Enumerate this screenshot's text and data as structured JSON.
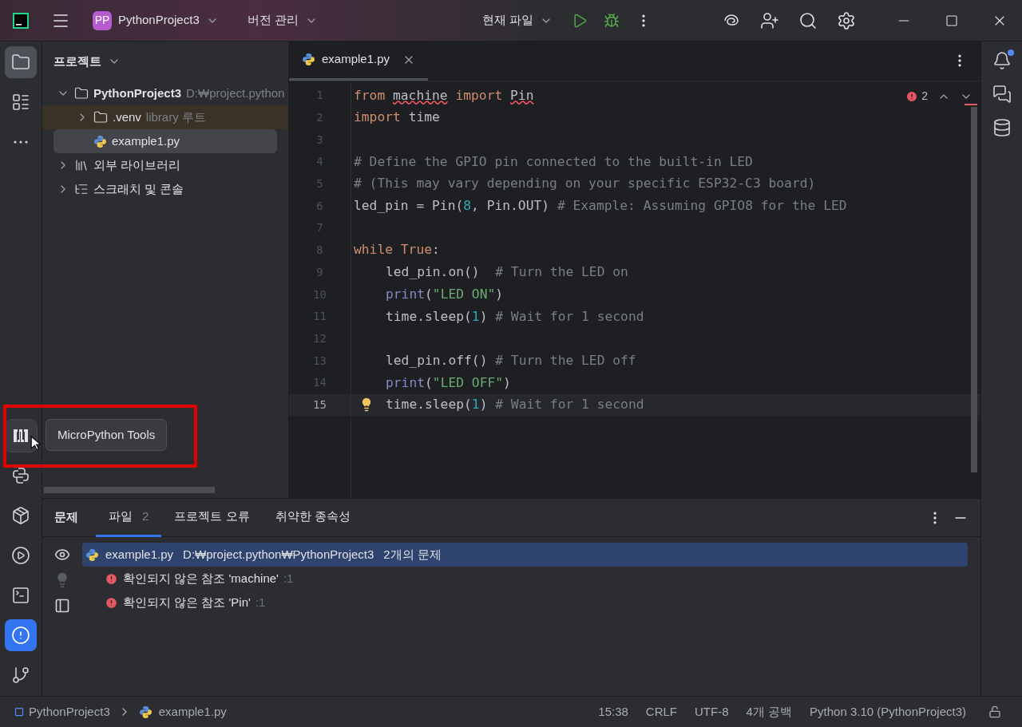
{
  "title_bar": {
    "project_badge": "PP",
    "project": "PythonProject3",
    "vcs": "버전 관리",
    "run_config": "현재 파일"
  },
  "tool_strip": {
    "top": [
      {
        "kind": "folder",
        "selected": true,
        "hovered": false
      },
      {
        "kind": "structure",
        "selected": false,
        "hovered": false
      },
      {
        "kind": "more",
        "selected": false,
        "hovered": false
      }
    ],
    "bottom": [
      {
        "kind": "micropython",
        "selected": false,
        "hovered": true
      },
      {
        "kind": "python",
        "selected": false,
        "hovered": false
      },
      {
        "kind": "packages",
        "selected": false,
        "hovered": false
      },
      {
        "kind": "run",
        "selected": false,
        "hovered": false
      },
      {
        "kind": "terminal",
        "selected": false,
        "hovered": false
      },
      {
        "kind": "problems",
        "selected": true,
        "hovered": false
      },
      {
        "kind": "git",
        "selected": false,
        "hovered": false
      }
    ]
  },
  "tooltip": "MicroPython Tools",
  "project_panel": {
    "title": "프로젝트",
    "tree": [
      {
        "kind": "folder",
        "label": "PythonProject3",
        "note": "D:₩project.python",
        "expanded": true,
        "selected": false,
        "excluded": false,
        "children": [
          {
            "kind": "folder",
            "label": ".venv",
            "note": "library 루트",
            "expanded": false,
            "selected": false,
            "excluded": true
          },
          {
            "kind": "python",
            "label": "example1.py",
            "selected": true,
            "excluded": false
          }
        ]
      },
      {
        "kind": "library",
        "label": "외부 라이브러리",
        "expanded": false,
        "selected": false,
        "excluded": false
      },
      {
        "kind": "scratch",
        "label": "스크래치 및 콘솔",
        "expanded": false,
        "selected": false,
        "excluded": false
      }
    ]
  },
  "editor": {
    "tab": "example1.py",
    "error_count": "2",
    "lines": [
      {
        "number": "1",
        "current": false,
        "bulb": false,
        "indent": false,
        "tokens": [
          {
            "kind": "kw",
            "text": "from "
          },
          {
            "kind": "err",
            "text": "machine"
          },
          {
            "kind": "kw",
            "text": " import "
          },
          {
            "kind": "err",
            "text": "Pin"
          }
        ]
      },
      {
        "number": "2",
        "current": false,
        "bulb": false,
        "indent": false,
        "tokens": [
          {
            "kind": "kw",
            "text": "import "
          },
          {
            "kind": "text",
            "text": "time"
          }
        ]
      },
      {
        "number": "3",
        "current": false,
        "bulb": false
      },
      {
        "number": "4",
        "current": false,
        "bulb": false,
        "indent": false,
        "tokens": [
          {
            "kind": "comment",
            "text": "# Define the GPIO pin connected to the built-in LED"
          }
        ]
      },
      {
        "number": "5",
        "current": false,
        "bulb": false,
        "indent": false,
        "tokens": [
          {
            "kind": "comment",
            "text": "# (This may vary depending on your specific ESP32-C3 board)"
          }
        ]
      },
      {
        "number": "6",
        "current": false,
        "bulb": false,
        "indent": false,
        "tokens": [
          {
            "kind": "text",
            "text": "led_pin = Pin("
          },
          {
            "kind": "num",
            "text": "8"
          },
          {
            "kind": "text",
            "text": ", Pin.OUT) "
          },
          {
            "kind": "comment",
            "text": "# Example: Assuming GPIO8 for the LED"
          }
        ]
      },
      {
        "number": "7",
        "current": false,
        "bulb": false
      },
      {
        "number": "8",
        "current": false,
        "bulb": false,
        "indent": false,
        "tokens": [
          {
            "kind": "kw",
            "text": "while True"
          },
          {
            "kind": "text",
            "text": ":"
          }
        ]
      },
      {
        "number": "9",
        "current": false,
        "bulb": false,
        "indent": true,
        "tokens": [
          {
            "kind": "text",
            "text": "led_pin.on()  "
          },
          {
            "kind": "comment",
            "text": "# Turn the LED on"
          }
        ]
      },
      {
        "number": "10",
        "current": false,
        "bulb": false,
        "indent": true,
        "tokens": [
          {
            "kind": "builtin",
            "text": "print"
          },
          {
            "kind": "text",
            "text": "("
          },
          {
            "kind": "str",
            "text": "\"LED ON\""
          },
          {
            "kind": "text",
            "text": ")"
          }
        ]
      },
      {
        "number": "11",
        "current": false,
        "bulb": false,
        "indent": true,
        "tokens": [
          {
            "kind": "text",
            "text": "time.sleep("
          },
          {
            "kind": "num",
            "text": "1"
          },
          {
            "kind": "text",
            "text": ") "
          },
          {
            "kind": "comment",
            "text": "# Wait for 1 second"
          }
        ]
      },
      {
        "number": "12",
        "current": false,
        "bulb": false
      },
      {
        "number": "13",
        "current": false,
        "bulb": false,
        "indent": true,
        "tokens": [
          {
            "kind": "text",
            "text": "led_pin.off() "
          },
          {
            "kind": "comment",
            "text": "# Turn the LED off"
          }
        ]
      },
      {
        "number": "14",
        "current": false,
        "bulb": false,
        "indent": true,
        "tokens": [
          {
            "kind": "builtin",
            "text": "print"
          },
          {
            "kind": "text",
            "text": "("
          },
          {
            "kind": "str",
            "text": "\"LED OFF\""
          },
          {
            "kind": "text",
            "text": ")"
          }
        ]
      },
      {
        "number": "15",
        "current": true,
        "bulb": true,
        "indent": true,
        "tokens": [
          {
            "kind": "text",
            "text": "time.sleep("
          },
          {
            "kind": "num",
            "text": "1"
          },
          {
            "kind": "text",
            "text": ") "
          },
          {
            "kind": "comment",
            "text": "# Wait for 1 second"
          }
        ]
      }
    ]
  },
  "problems": {
    "title": "문제",
    "tabs": [
      {
        "label": "파일",
        "count": "2",
        "selected": true
      },
      {
        "label": "프로젝트 오류",
        "selected": false
      },
      {
        "label": "취약한 종속성",
        "selected": false
      }
    ],
    "file": {
      "name": "example1.py",
      "path": "D:₩project.python₩PythonProject3",
      "summary": "2개의 문제",
      "selected": true
    },
    "items": [
      {
        "text": "확인되지 않은 참조 'machine'",
        "line": ":1"
      },
      {
        "text": "확인되지 않은 참조 'Pin'",
        "line": ":1"
      }
    ]
  },
  "status_bar": {
    "breadcrumbs": [
      "PythonProject3",
      "example1.py"
    ],
    "items": [
      "15:38",
      "CRLF",
      "UTF-8",
      "4개 공백",
      "Python 3.10 (PythonProject3)"
    ]
  }
}
